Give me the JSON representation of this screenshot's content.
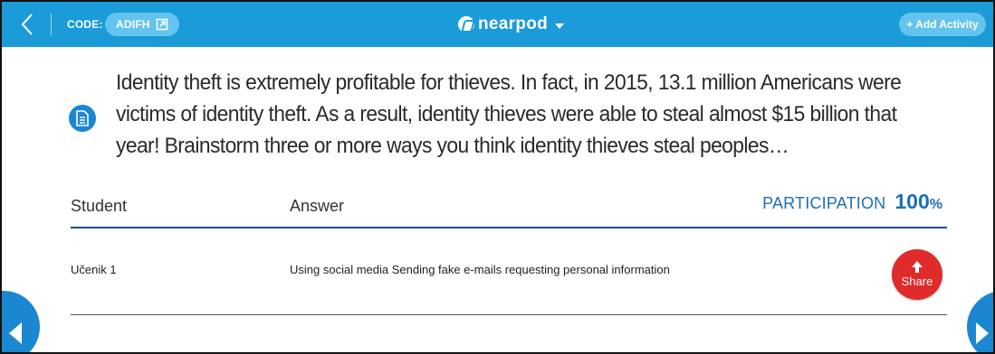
{
  "topbar": {
    "code_label": "CODE:",
    "code_value": "ADIFH",
    "logo_text": "nearpod",
    "add_activity_label": "+ Add Activity",
    "icons": [
      "back-arrow-icon",
      "external-link-icon",
      "nearpod-logo-icon",
      "caret-down-icon"
    ]
  },
  "question": {
    "icon": "document-icon",
    "text": "Identity theft is extremely profitable for thieves. In fact, in 2015, 13.1 million Americans were victims of identity theft. As a result, identity thieves were able to steal almost $15 billion that year! Brainstorm three or more ways you think identity thieves steal peoples…"
  },
  "table": {
    "columns": [
      "Student",
      "Answer"
    ],
    "participation_label": "PARTICIPATION",
    "participation_value": "100",
    "participation_unit": "%",
    "rows": [
      {
        "student": "Učenik 1",
        "answer": "Using social media Sending fake e-mails requesting personal information",
        "share_label": "Share"
      }
    ]
  },
  "navigation": {
    "icons": [
      "prev-slide-icon",
      "next-slide-icon"
    ]
  },
  "colors": {
    "topbar": "#1b9bd8",
    "pill": "#63c4ee",
    "accent_blue": "#1b6fb8",
    "share_red": "#e02b2b",
    "nav_blue": "#1b87d1"
  }
}
